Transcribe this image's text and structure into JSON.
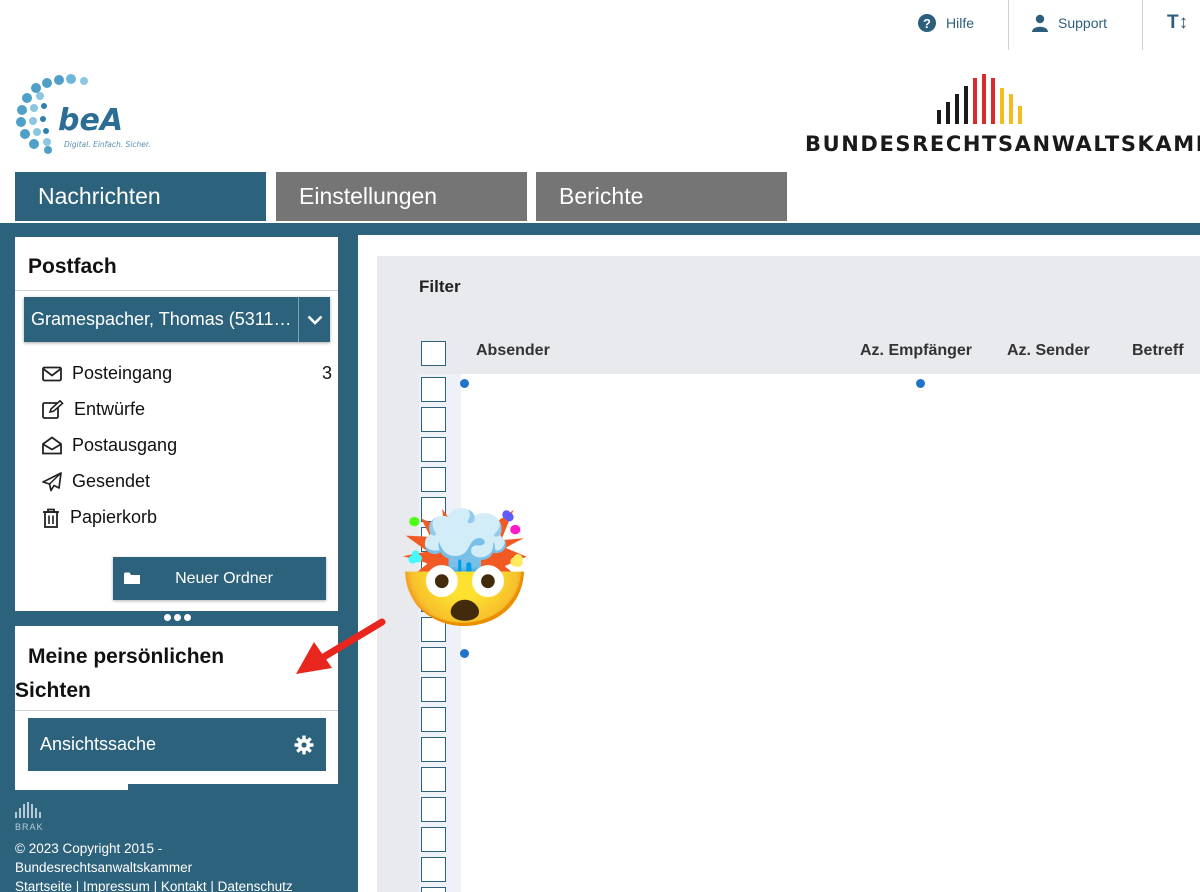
{
  "utility": {
    "help_label": "Hilfe",
    "support_label": "Support",
    "textsize_glyph": "T↕"
  },
  "logos": {
    "bea_name": "beA",
    "bea_tagline": "Digital. Einfach. Sicher.",
    "brak_name": "BUNDESRECHTSANWALTSKAMMER"
  },
  "tabs": [
    {
      "label": "Nachrichten",
      "active": true
    },
    {
      "label": "Einstellungen",
      "active": false
    },
    {
      "label": "Berichte",
      "active": false
    }
  ],
  "sidebar": {
    "postfach_title": "Postfach",
    "mailbox_selected": "Gramespacher, Thomas (5311…",
    "folders": [
      {
        "label": "Posteingang",
        "icon": "envelope-icon",
        "count": "3"
      },
      {
        "label": "Entwürfe",
        "icon": "edit-icon",
        "count": ""
      },
      {
        "label": "Postausgang",
        "icon": "open-envelope-icon",
        "count": ""
      },
      {
        "label": "Gesendet",
        "icon": "paper-plane-icon",
        "count": ""
      },
      {
        "label": "Papierkorb",
        "icon": "trash-icon",
        "count": ""
      }
    ],
    "new_folder_label": "Neuer Ordner",
    "views_title_line1": "Meine persönlichen",
    "views_title_line2": "Sichten",
    "views": [
      {
        "label": "Ansichtssache",
        "icon": "gear-icon"
      }
    ]
  },
  "footer": {
    "brak_mini": "BRAK",
    "copyright_line1": "© 2023 Copyright 2015 -",
    "copyright_line2": "Bundesrechtsanwaltskammer",
    "links": [
      "Startseite",
      "Impressum",
      "Kontakt",
      "Datenschutz"
    ]
  },
  "content": {
    "filter_label": "Filter",
    "columns": [
      "Absender",
      "Az. Empfänger",
      "Az. Sender",
      "Betreff"
    ],
    "unread_rows": [
      0,
      9
    ]
  },
  "colors": {
    "brand": "#2d627c",
    "inactive_tab": "#757575",
    "unread_dot": "#1f74c9",
    "arrow": "#e8261e"
  },
  "decoration": {
    "emoji": "🤯"
  }
}
